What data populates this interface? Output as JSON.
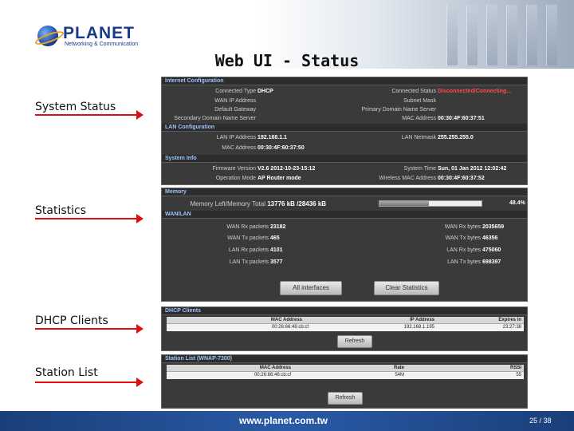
{
  "brand": {
    "name": "PLANET",
    "tagline": "Networking & Communication"
  },
  "slide_title": "Web UI - Status",
  "labels": {
    "system_status": "System Status",
    "statistics": "Statistics",
    "dhcp": "DHCP Clients",
    "station": "Station List"
  },
  "status": {
    "internet_header": "Internet Configuration",
    "conn_type_k": "Connected Type",
    "conn_type_v": "DHCP",
    "conn_status_k": "Connected Status",
    "conn_status_v": "Disconnected/Connecting...",
    "wan_ip_k": "WAN IP Address",
    "subnet_k": "Subnet Mask",
    "gw_k": "Default Gateway",
    "pdns_k": "Primary Domain Name Server",
    "sdns_k": "Secondary Domain Name Server",
    "mac_k": "MAC Address",
    "mac_v": "00:30:4F:60:37:51",
    "lan_header": "LAN Configuration",
    "lan_ip_k": "LAN IP Address",
    "lan_ip_v": "192.168.1.1",
    "lan_mask_k": "LAN Netmask",
    "lan_mask_v": "255.255.255.0",
    "lan_mac_k": "MAC Address",
    "lan_mac_v": "00:30:4F:60:37:50",
    "sys_header": "System Info",
    "fw_k": "Firmware Version",
    "fw_v": "V2.6 2012-10-23-15:12",
    "time_k": "System Time",
    "time_v": "Sun, 01 Jan 2012 12:02:42",
    "mode_k": "Operation Mode",
    "mode_v": "AP Router mode",
    "wmac_k": "Wireless MAC Address",
    "wmac_v": "00:30:4F:60:37:52"
  },
  "stats": {
    "memory_header": "Memory",
    "mem_k": "Memory Left/Memory Total",
    "mem_v": "13776 kB /28436 kB",
    "mem_pct": "48.4%",
    "mem_fraction": 0.484,
    "wanlan_header": "WAN/LAN",
    "wan_rx_pk_k": "WAN Rx packets",
    "wan_rx_pk_v": "23182",
    "wan_rx_by_k": "WAN Rx bytes",
    "wan_rx_by_v": "2035659",
    "wan_tx_pk_k": "WAN Tx packets",
    "wan_tx_pk_v": "465",
    "wan_tx_by_k": "WAN Tx bytes",
    "wan_tx_by_v": "46356",
    "lan_rx_pk_k": "LAN Rx packets",
    "lan_rx_pk_v": "4101",
    "lan_rx_by_k": "LAN Rx bytes",
    "lan_rx_by_v": "475060",
    "lan_tx_pk_k": "LAN Tx packets",
    "lan_tx_pk_v": "3577",
    "lan_tx_by_k": "LAN Tx bytes",
    "lan_tx_by_v": "698397",
    "btn_all": "All interfaces",
    "btn_clear": "Clear Statistics"
  },
  "dhcp": {
    "header": "DHCP Clients",
    "cols": [
      "MAC Address",
      "IP Address",
      "Expires in"
    ],
    "row": [
      "00:26:66:46:cb:cf",
      "192.168.1.195",
      "23:27:38"
    ],
    "refresh": "Refresh"
  },
  "station": {
    "header": "Station List (WNAP-7300)",
    "cols": [
      "MAC Address",
      "Rate",
      "RSSI"
    ],
    "row": [
      "00:26:66:46:cb:cf",
      "54M",
      "55"
    ],
    "refresh": "Refresh"
  },
  "footer": {
    "url": "www.planet.com.tw",
    "page": "25 / 38"
  }
}
